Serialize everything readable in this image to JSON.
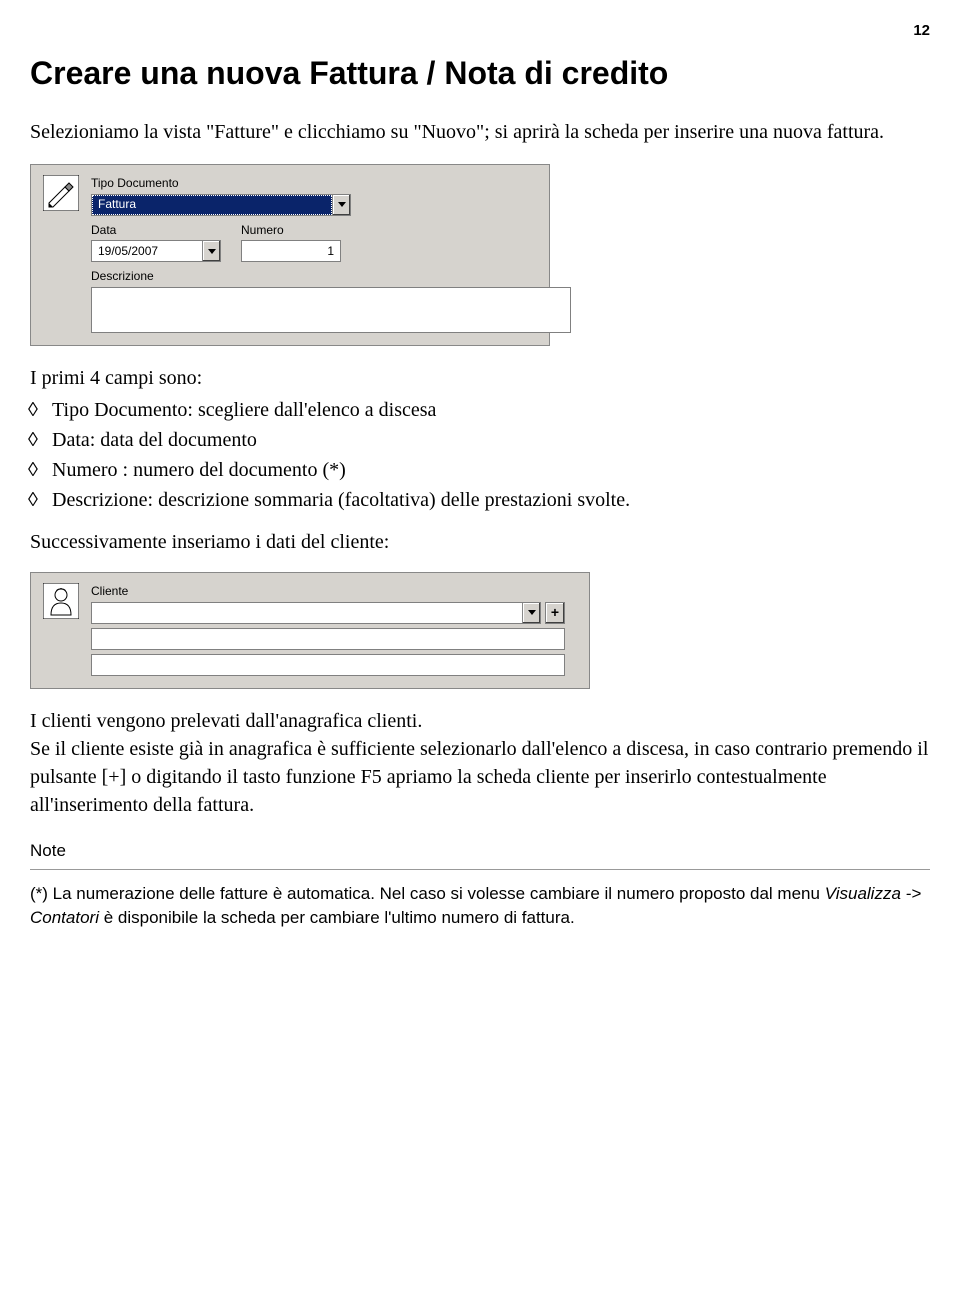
{
  "page_number": "12",
  "heading": "Creare una nuova Fattura / Nota di credito",
  "intro": "Selezioniamo la vista \"Fatture\" e clicchiamo su \"Nuovo\"; si aprirà la scheda per inserire una nuova fattura.",
  "panel1": {
    "tipo_label": "Tipo Documento",
    "tipo_value": "Fattura",
    "data_label": "Data",
    "data_value": "19/05/2007",
    "numero_label": "Numero",
    "numero_value": "1",
    "descrizione_label": "Descrizione"
  },
  "fields_intro": "I primi 4 campi sono:",
  "bullets": [
    "Tipo Documento: scegliere dall'elenco a discesa",
    "Data: data del documento",
    "Numero : numero del documento (*)",
    "Descrizione: descrizione sommaria (facoltativa) delle prestazioni svolte."
  ],
  "para2": "Successivamente inseriamo i dati del cliente:",
  "panel2": {
    "cliente_label": "Cliente",
    "plus_label": "+"
  },
  "para3": "I clienti vengono prelevati dall'anagrafica clienti.",
  "para4": "Se il cliente esiste già in anagrafica è sufficiente selezionarlo dall'elenco a discesa, in caso contrario premendo il pulsante [+] o digitando il tasto funzione F5 apriamo la scheda cliente per inserirlo contestualmente all'inserimento della fattura.",
  "note_heading": "Note",
  "note_text_1": "(*) La numerazione delle fatture è automatica. Nel caso si volesse cambiare il numero proposto dal menu ",
  "note_text_italic": "Visualizza -> Contatori",
  "note_text_2": " è disponibile la scheda per cambiare l'ultimo numero di fattura."
}
